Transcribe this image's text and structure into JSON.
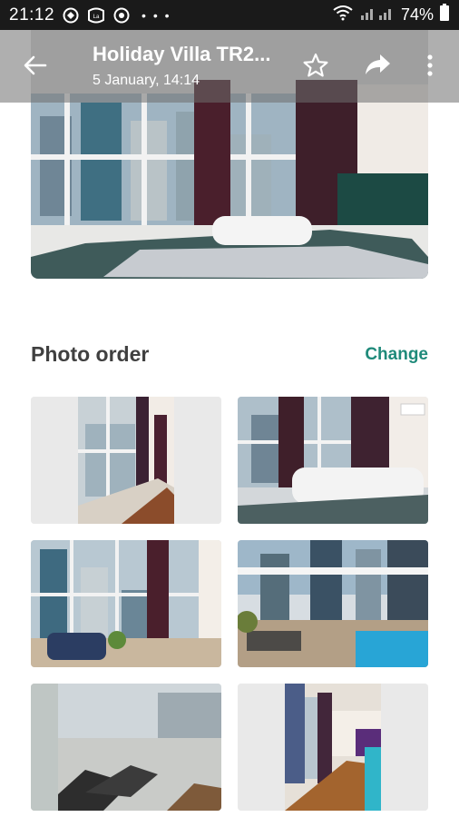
{
  "status": {
    "time": "21:12",
    "battery": "74%"
  },
  "header": {
    "title": "Holiday Villa TR2...",
    "subtitle": "5 January, 14:14"
  },
  "section": {
    "title": "Photo order",
    "change_label": "Change"
  },
  "colors": {
    "accent": "#1f8a7a",
    "appbar": "#6e6e6e",
    "status_bar": "#1a1a1a"
  },
  "icons": [
    "back-arrow-icon",
    "star-icon",
    "share-icon",
    "more-vert-icon",
    "wifi-icon",
    "signal-icon",
    "battery-icon"
  ]
}
